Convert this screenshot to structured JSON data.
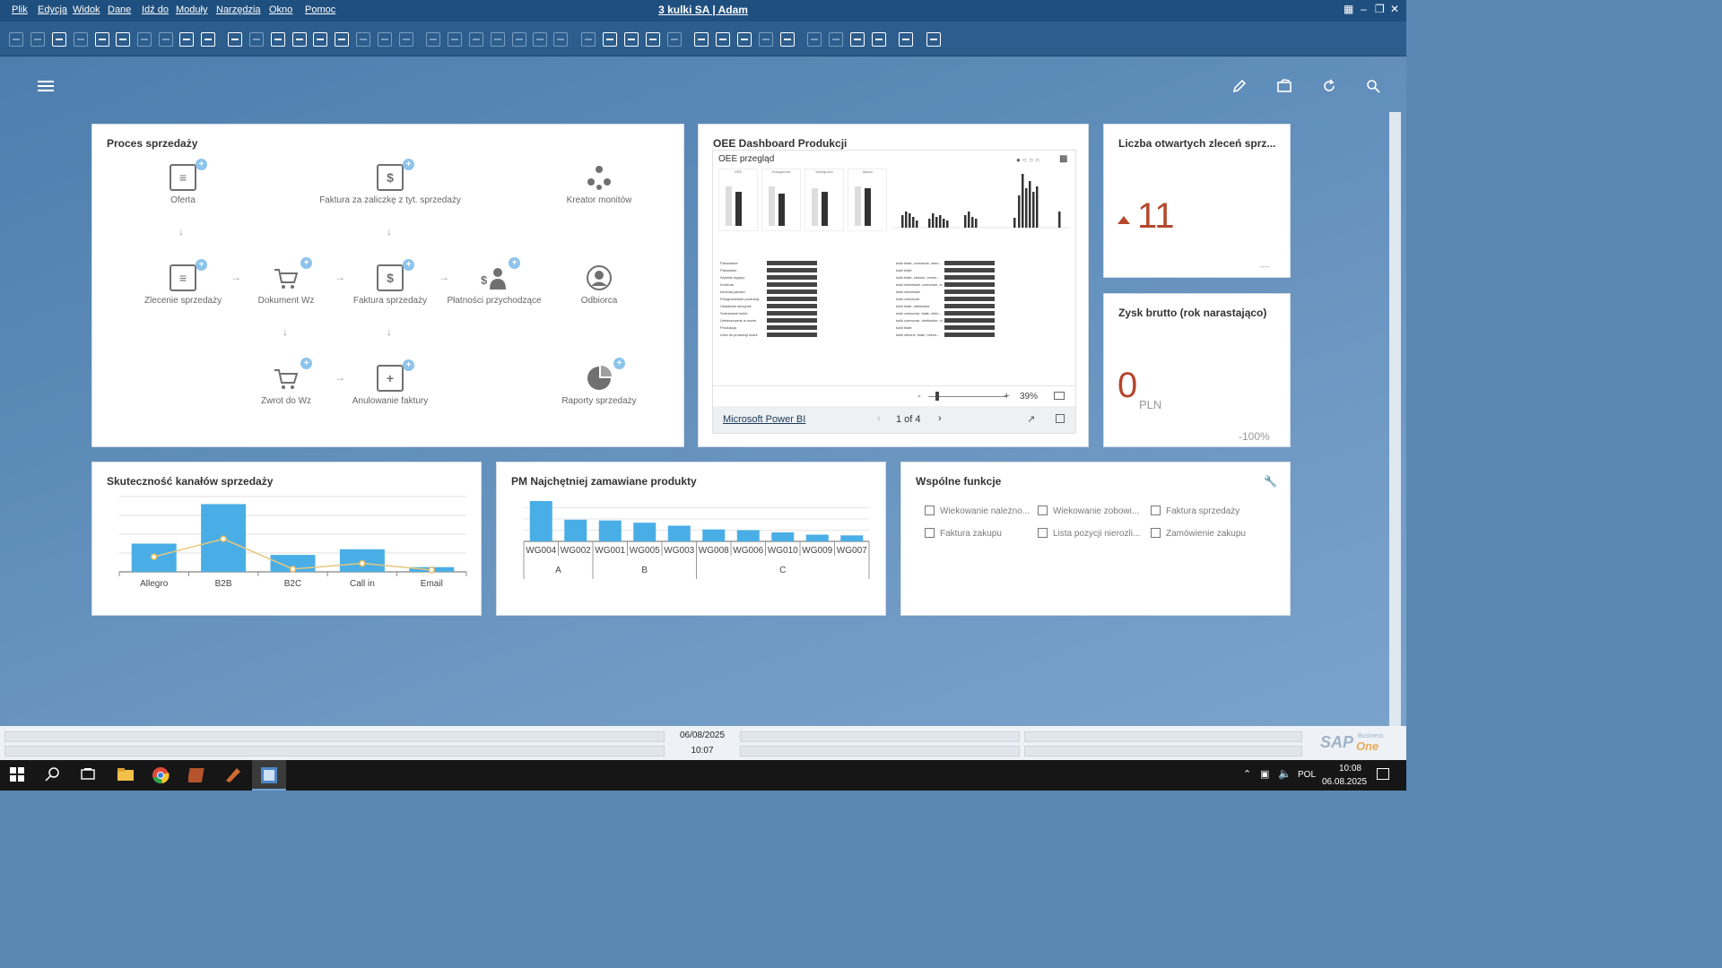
{
  "menubar": {
    "items": [
      "Plik",
      "Edycja",
      "Widok",
      "Dane",
      "Idź do",
      "Moduły",
      "Narzędzia",
      "Okno",
      "Pomoc"
    ],
    "window_title": "3 kulki SA | Adam"
  },
  "process": {
    "title": "Proces sprzedaży",
    "nodes": {
      "oferta": "Oferta",
      "faktura_zaliczka": "Faktura za zaliczkę z tyt. sprzedaży",
      "kreator": "Kreator monitów",
      "zlecenie": "Zlecenie sprzedaży",
      "wz": "Dokument Wz",
      "faktura": "Faktura sprzedaży",
      "platnosci": "Płatności przychodzące",
      "odbiorca": "Odbiorca",
      "zwrot": "Zwrot do Wz",
      "anulowanie": "Anulowanie faktury",
      "raporty": "Raporty sprzedaży"
    }
  },
  "oee": {
    "title": "OEE Dashboard Produkcji",
    "report_title": "OEE przegląd",
    "zoom": "39%",
    "powerbi_link": "Microsoft Power BI",
    "page_indicator": "1 of 4",
    "mini": {
      "kpis": [
        "OEE",
        "Dostępność",
        "Wydajność",
        "Jakość"
      ],
      "left_rows": [
        "Pakowanie",
        "Palowanie",
        "Wysłoik myjący",
        "Kontrola",
        "kontrola jakości",
        "Przygotowanie produkcji",
        "Układanie skrzynek",
        "Sortowanie kulek",
        "Umieszczanie w wozie",
        "Produkcja",
        "Linia do produkcji kulek"
      ],
      "right_rows": [
        "kulki białe, czerwone, zielo...",
        "kulki białe",
        "kulki białe, zielone, czerw...",
        "kulki niebieskie, czerwone, zi...",
        "kulki niebieskie",
        "kulki czerwone",
        "kulki białe, niebieskie",
        "kulki czerwone, białe, zielo...",
        "kulki czerwone, niebieskie, ni...",
        "kulki białe",
        "kulki zielone, białe, czerw..."
      ]
    }
  },
  "kpi_open_orders": {
    "title": "Liczba otwartych zleceń sprz...",
    "value": "11",
    "footer": "----"
  },
  "kpi_profit": {
    "title": "Zysk brutto (rok narastająco)",
    "value": "0",
    "unit": "PLN",
    "change": "-100%"
  },
  "charts": {
    "channels_title": "Skuteczność kanałów sprzedaży",
    "products_title": "PM Najchętniej zamawiane produkty"
  },
  "chart_data": [
    {
      "type": "bar",
      "title": "Skuteczność kanałów sprzedaży",
      "categories": [
        "Allegro",
        "B2B",
        "B2C",
        "Call in",
        "Email"
      ],
      "series": [
        {
          "type": "bar",
          "values": [
            30,
            72,
            18,
            24,
            5
          ]
        },
        {
          "type": "line",
          "values": [
            16,
            35,
            3,
            9,
            2
          ]
        }
      ],
      "ylim": [
        0,
        80
      ]
    },
    {
      "type": "bar",
      "title": "PM Najchętniej zamawiane produkty",
      "categories": [
        "WG004",
        "WG002",
        "WG001",
        "WG005",
        "WG003",
        "WG008",
        "WG006",
        "WG010",
        "WG009",
        "WG007"
      ],
      "groups": [
        {
          "label": "A",
          "count": 2
        },
        {
          "label": "B",
          "count": 3
        },
        {
          "label": "C",
          "count": 5
        }
      ],
      "values": [
        54,
        29,
        28,
        25,
        21,
        16,
        15,
        12,
        9,
        8
      ],
      "ylim": [
        0,
        60
      ]
    }
  ],
  "shared": {
    "title": "Wspólne funkcje",
    "items": [
      "Wiekowanie należno...",
      "Wiekowanie zobowi...",
      "Faktura sprzedaży",
      "Faktura zakupu",
      "Lista pozycji nierozli...",
      "Zamówienie zakupu"
    ]
  },
  "statusbar": {
    "date": "06/08/2025",
    "time": "10:07",
    "brand_main": "SAP",
    "brand_sub1": "Business",
    "brand_sub2": "One"
  },
  "taskbar": {
    "lang": "POL",
    "time": "10:08",
    "date": "06.08.2025"
  }
}
